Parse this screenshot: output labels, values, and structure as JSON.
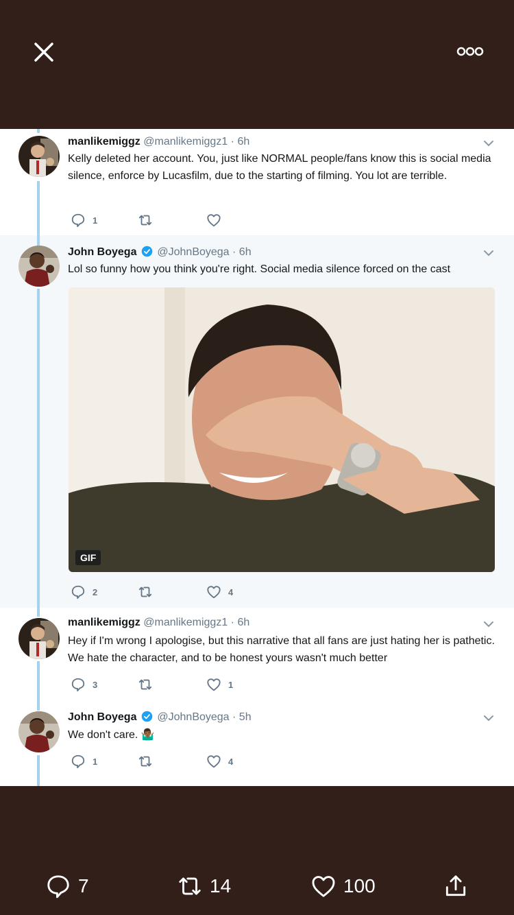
{
  "top_bar": {
    "close_icon": "close-icon",
    "more_icon": "more-options-icon"
  },
  "tweets": [
    {
      "name": "manlikemiggz",
      "handle": "@manlikemiggz1",
      "time": "· 6h",
      "verified": false,
      "text": "Kelly deleted her account. You, just like NORMAL people/fans know this is social media silence, enforce by Lucasfilm, due to the starting of filming. You lot are terrible.",
      "replies": "1",
      "retweets": "",
      "likes": ""
    },
    {
      "name": "John Boyega",
      "handle": "@JohnBoyega",
      "time": "· 6h",
      "verified": true,
      "text": "Lol so funny how you think you're right. Social media silence forced on the cast",
      "media_badge": "GIF",
      "replies": "2",
      "retweets": "",
      "likes": "4"
    },
    {
      "name": "manlikemiggz",
      "handle": "@manlikemiggz1",
      "time": "· 6h",
      "verified": false,
      "text": "Hey if I'm wrong I apologise, but this narrative that all fans are just hating her is pathetic. We hate the character, and to be honest yours wasn't much better",
      "replies": "3",
      "retweets": "",
      "likes": "1"
    },
    {
      "name": "John Boyega",
      "handle": "@JohnBoyega",
      "time": "· 5h",
      "verified": true,
      "text": "We don't care. 🤷🏾‍♂️",
      "replies": "1",
      "retweets": "",
      "likes": "4"
    }
  ],
  "bottom_bar": {
    "replies": "7",
    "retweets": "14",
    "likes": "100"
  },
  "colors": {
    "background": "#331f1a",
    "thread_line": "#a4d2ef",
    "verified": "#1da1f2",
    "text": "#14171a",
    "muted": "#657786"
  }
}
